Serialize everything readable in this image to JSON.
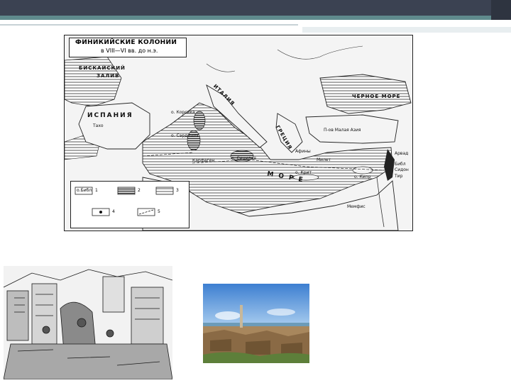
{
  "slide": {
    "map": {
      "title_line1": "ФИНИКИЙСКИЕ КОЛОНИИ",
      "title_line2": "в VIII—VI вв. до н.э.",
      "labels": {
        "biscay": "БИСКАЙСКИЙ",
        "biscay2": "ЗАЛИВ",
        "spain": "ИСПАНИЯ",
        "italy": "ИТАЛИЯ",
        "greece": "ГРЕЦИЯ",
        "black_sea": "ЧЕРНОЕ МОРЕ",
        "sea": "М О Р Е",
        "asia_minor": "П-ов Малая Азия",
        "corsica": "о. Корсика",
        "sardinia": "о. Сардиния",
        "sicily": "о. Сицилия",
        "carthage": "Карфаген",
        "crete": "о. Крит",
        "cyprus": "о. Кипр",
        "memphis": "Мемфис",
        "tyre": "Тир",
        "sidon": "Сидон",
        "byblos": "Библ",
        "arvad": "Арвад",
        "miletus": "Милет",
        "athens": "Афины",
        "tagus": "Тахо"
      },
      "legend": {
        "item1": "о.Библ",
        "n1": "1",
        "n2": "2",
        "n3": "3",
        "n4": "4",
        "n5": "5"
      }
    }
  }
}
